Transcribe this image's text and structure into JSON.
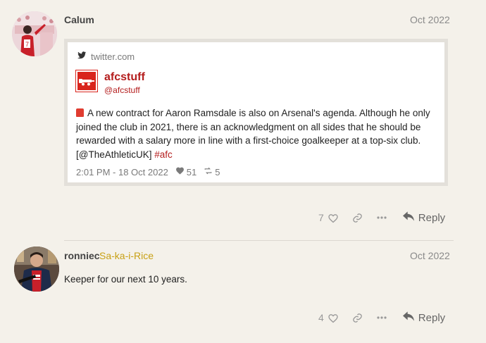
{
  "posts": [
    {
      "username": "Calum",
      "date": "Oct 2022",
      "avatar": "calum-avatar",
      "onebox": {
        "source": "twitter.com",
        "source_icon": "twitter-bird-icon",
        "account_name": "afcstuff",
        "account_handle": "@afcstuff",
        "text_main": "A new contract for Aaron Ramsdale is also on Arsenal's agenda. Although he only joined the club in 2021, there is an acknowledgment on all sides that he should be rewarded with a salary more in line with a first-choice goalkeeper at a top-six club. [@TheAthleticUK] ",
        "hashtag": "#afc",
        "timestamp": "2:01 PM - 18 Oct 2022",
        "likes": "51",
        "retweets": "5"
      },
      "like_count": "7",
      "reply_label": "Reply"
    },
    {
      "username": "ronniec",
      "flair": "Sa-ka-i-Rice",
      "date": "Oct 2022",
      "avatar": "ronniec-avatar",
      "body": "Keeper for our next 10 years.",
      "like_count": "4",
      "reply_label": "Reply"
    }
  ],
  "colors": {
    "background": "#f4f1ea",
    "accent": "#b41d1d",
    "flair": "#c8a116"
  }
}
